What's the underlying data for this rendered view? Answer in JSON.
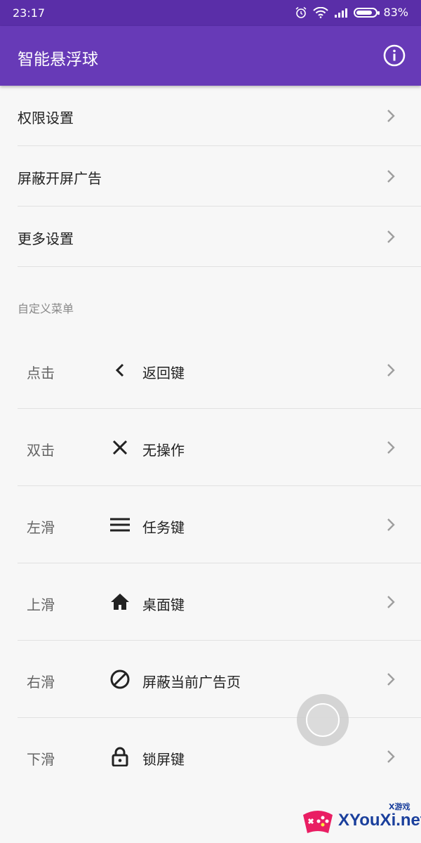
{
  "status_bar": {
    "time": "23:17",
    "battery_percent": "83%"
  },
  "app_bar": {
    "title": "智能悬浮球",
    "info_icon": "info-icon"
  },
  "settings": [
    {
      "label": "权限设置"
    },
    {
      "label": "屏蔽开屏广告"
    },
    {
      "label": "更多设置"
    }
  ],
  "section_title": "自定义菜单",
  "menu": [
    {
      "gesture": "点击",
      "icon": "back-icon",
      "action": "返回键"
    },
    {
      "gesture": "双击",
      "icon": "close-icon",
      "action": "无操作"
    },
    {
      "gesture": "左滑",
      "icon": "menu-icon",
      "action": "任务键"
    },
    {
      "gesture": "上滑",
      "icon": "home-icon",
      "action": "桌面键"
    },
    {
      "gesture": "右滑",
      "icon": "block-icon",
      "action": "屏蔽当前广告页"
    },
    {
      "gesture": "下滑",
      "icon": "lock-icon",
      "action": "锁屏键"
    }
  ],
  "watermark": {
    "text": "XYouXi.net",
    "small": "X游戏"
  },
  "colors": {
    "app_bar": "#673ab7",
    "status_bar": "#5a2ea8",
    "background": "#f7f7f7"
  }
}
